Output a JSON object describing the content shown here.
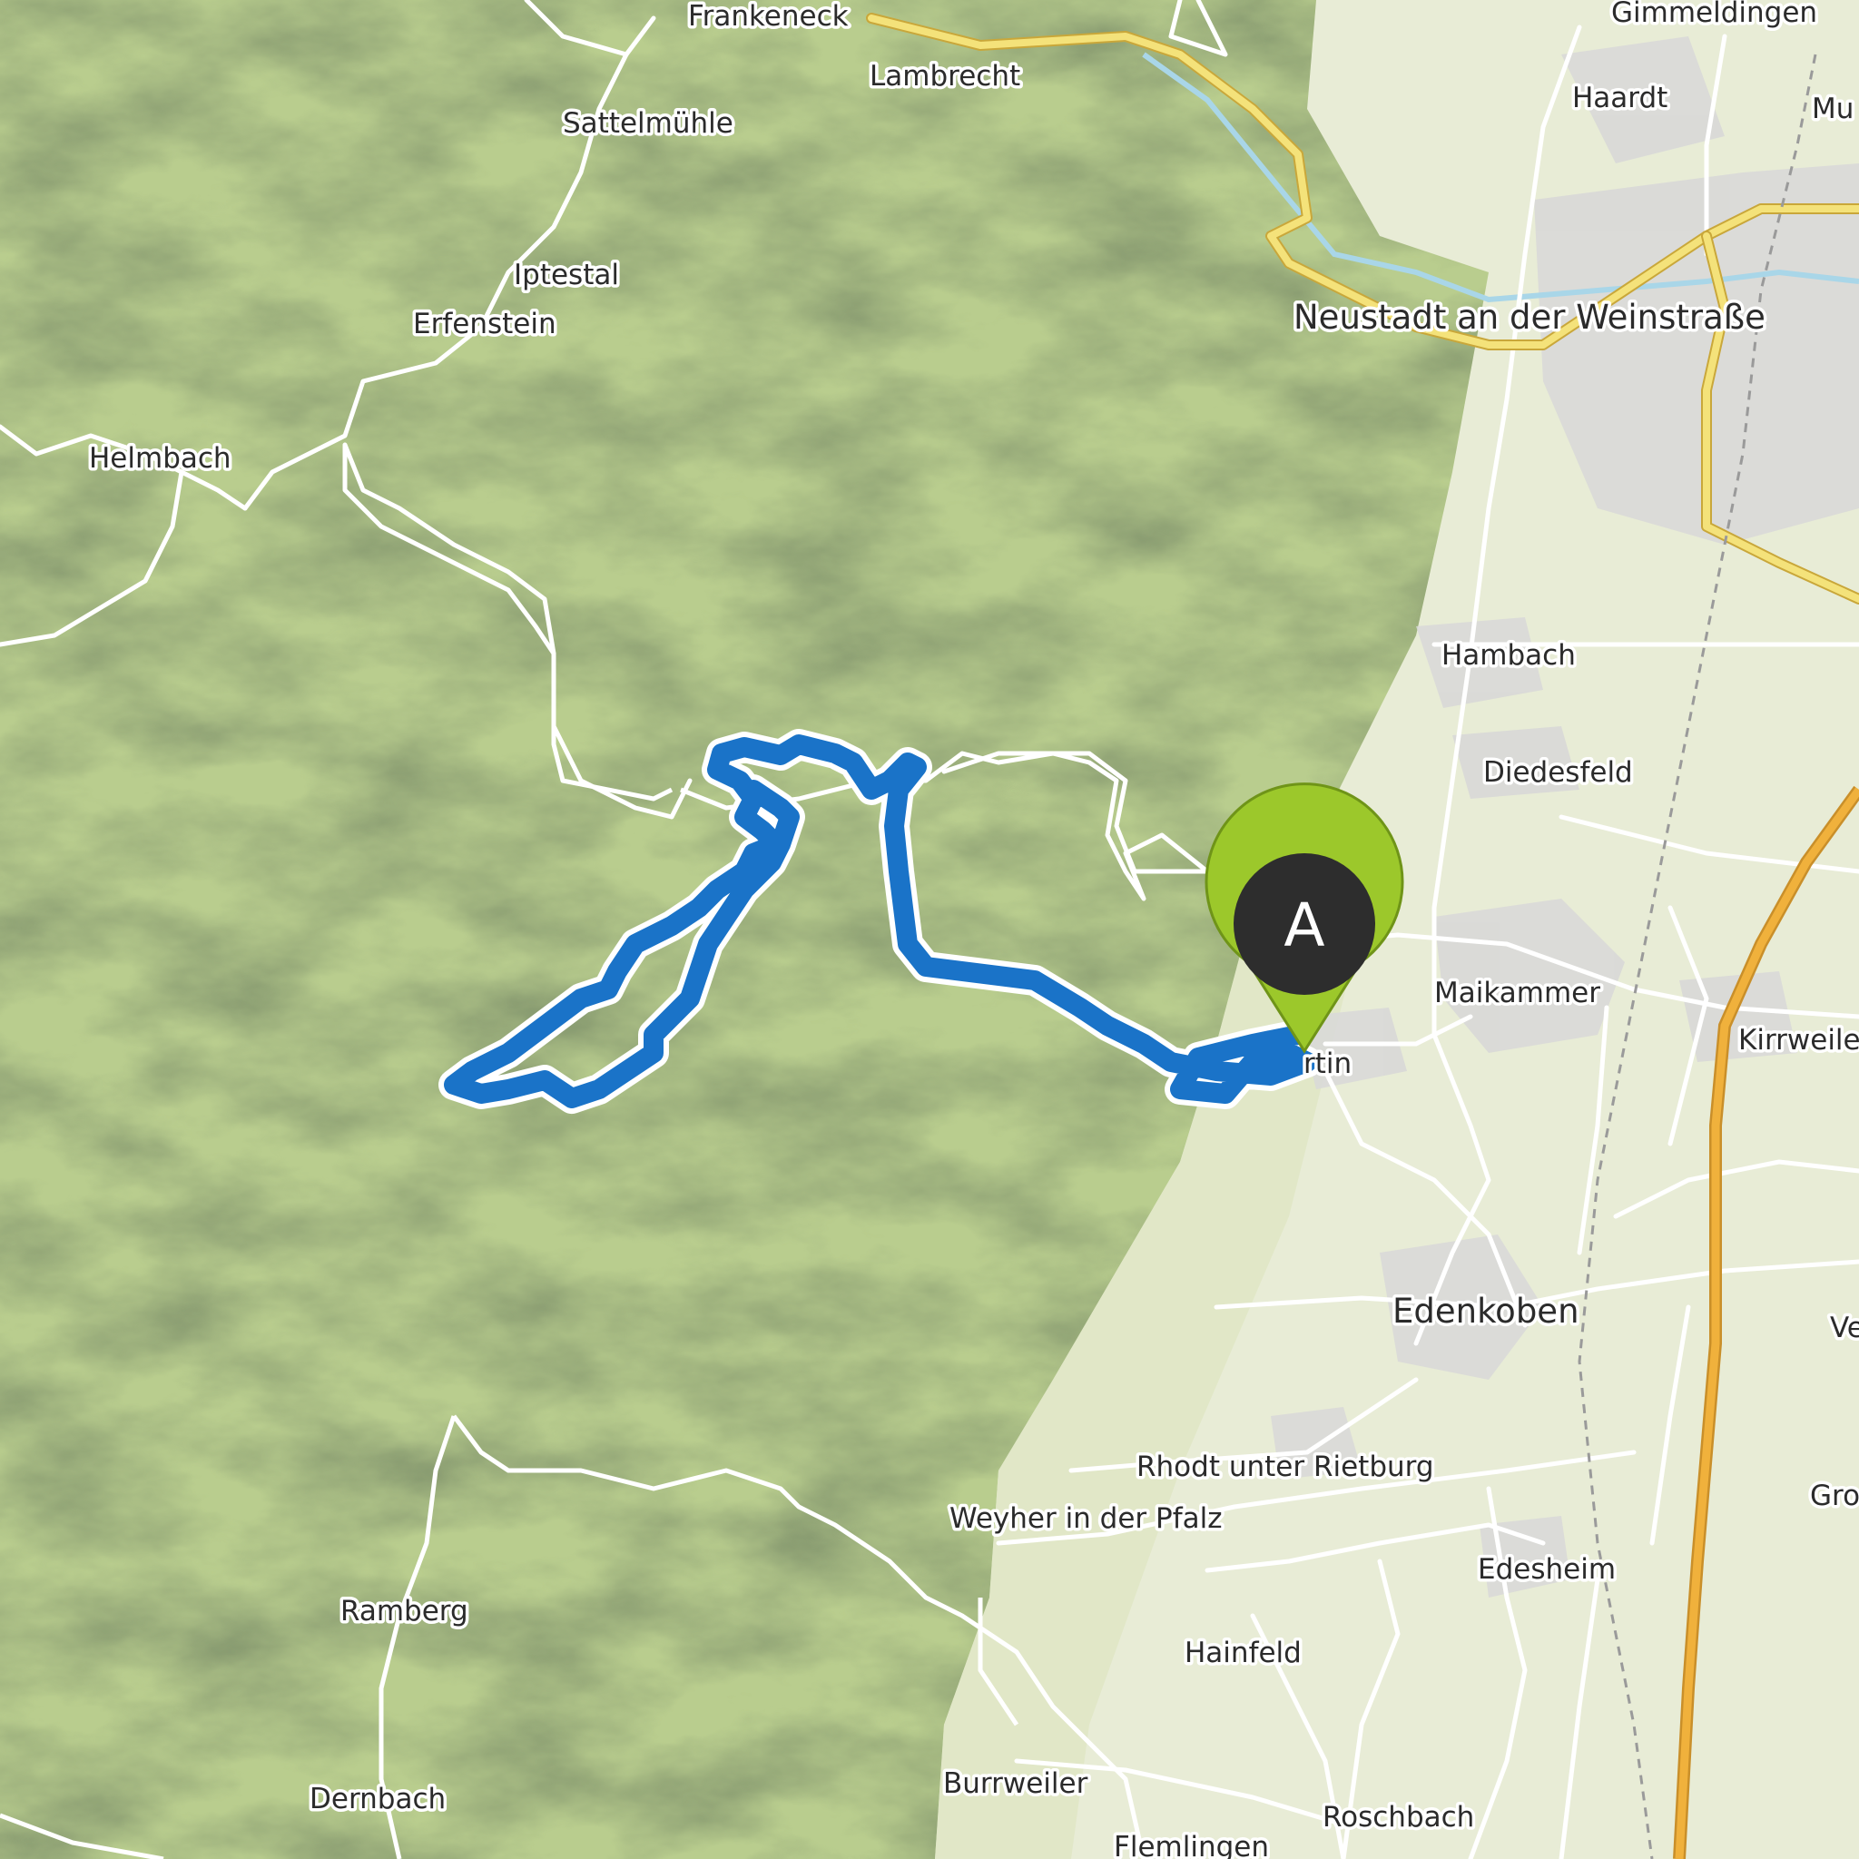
{
  "map": {
    "places": [
      {
        "id": "frankeneck",
        "name": "Frankeneck"
      },
      {
        "id": "gimmeldingen",
        "name": "Gimmeldingen"
      },
      {
        "id": "lambrecht",
        "name": "Lambrecht"
      },
      {
        "id": "haardt",
        "name": "Haardt"
      },
      {
        "id": "mu",
        "name": "Mu"
      },
      {
        "id": "sattelmuehle",
        "name": "Sattelmühle"
      },
      {
        "id": "iptestal",
        "name": "Iptestal"
      },
      {
        "id": "erfenstein",
        "name": "Erfenstein"
      },
      {
        "id": "neustadt",
        "name": "Neustadt an der Weinstraße"
      },
      {
        "id": "helmbach",
        "name": "Helmbach"
      },
      {
        "id": "hambach",
        "name": "Hambach"
      },
      {
        "id": "diedesfeld",
        "name": "Diedesfeld"
      },
      {
        "id": "maikammer",
        "name": "Maikammer"
      },
      {
        "id": "kirrweiler",
        "name": "Kirrweile"
      },
      {
        "id": "st-martin",
        "name": "rtin"
      },
      {
        "id": "edenkoben",
        "name": "Edenkoben"
      },
      {
        "id": "ve",
        "name": "Ve"
      },
      {
        "id": "rhodt",
        "name": "Rhodt unter Rietburg"
      },
      {
        "id": "weyher",
        "name": "Weyher in der Pfalz"
      },
      {
        "id": "gro",
        "name": "Gro"
      },
      {
        "id": "edesheim",
        "name": "Edesheim"
      },
      {
        "id": "ramberg",
        "name": "Ramberg"
      },
      {
        "id": "hainfeld",
        "name": "Hainfeld"
      },
      {
        "id": "burrweiler",
        "name": "Burrweiler"
      },
      {
        "id": "roschbach",
        "name": "Roschbach"
      },
      {
        "id": "dernbach",
        "name": "Dernbach"
      },
      {
        "id": "flemlingen",
        "name": "Flemlingen"
      }
    ],
    "start_marker": {
      "letter": "A"
    },
    "colors": {
      "route": "#1a73c8",
      "route_casing": "#ffffff",
      "forest": "#b9cd8e",
      "lowland": "#e8ecd6",
      "town": "#d8d8d8",
      "main_road": "#f4e27a",
      "motorway": "#f0b13c",
      "marker_pin": "#9cc82b",
      "marker_body": "#2d2d2d"
    }
  }
}
